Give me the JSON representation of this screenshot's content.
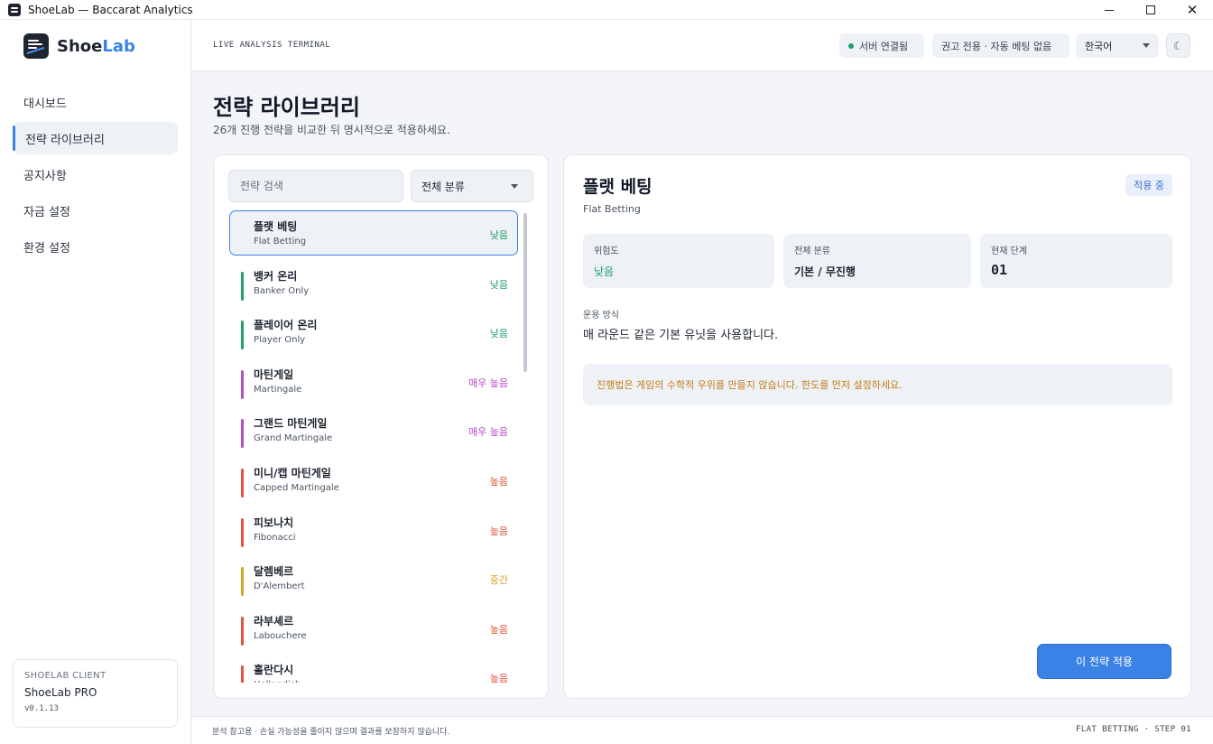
{
  "window": {
    "title": "ShoeLab — Baccarat Analytics",
    "controls": {
      "minimize": "",
      "maximize": "",
      "close": "✕"
    }
  },
  "sidebar": {
    "brand": {
      "prefix": "Shoe",
      "accent": "Lab"
    },
    "items": [
      {
        "label": "대시보드"
      },
      {
        "label": "전략 라이브러리",
        "active": true
      },
      {
        "label": "공지사항"
      },
      {
        "label": "자금 설정"
      },
      {
        "label": "환경 설정"
      }
    ],
    "client": {
      "label": "SHOELAB CLIENT",
      "name": "ShoeLab PRO",
      "version": "v0.1.13"
    }
  },
  "topbar": {
    "terminal_label": "LIVE ANALYSIS TERMINAL",
    "server_status": "서버 연결됨",
    "advice": "권고 전용 · 자동 베팅 없음",
    "language": "한국어",
    "theme_icon": "☾",
    "status_color": "#22a06b"
  },
  "main": {
    "title": "전략 라이브러리",
    "subtitle": "26개 진행 전략을 비교한 뒤 명시적으로 적용하세요."
  },
  "list": {
    "search_placeholder": "전략 검색",
    "category": "전체 분류",
    "strategies": [
      {
        "name": "플랫 베팅",
        "en": "Flat Betting",
        "risk": "낮음",
        "color": "#22a06b",
        "selected": true
      },
      {
        "name": "뱅커 온리",
        "en": "Banker Only",
        "risk": "낮음",
        "color": "#22a06b"
      },
      {
        "name": "플레이어 온리",
        "en": "Player Only",
        "risk": "낮음",
        "color": "#22a06b"
      },
      {
        "name": "마틴게일",
        "en": "Martingale",
        "risk": "매우 높음",
        "color": "#b44ec4"
      },
      {
        "name": "그랜드 마틴게일",
        "en": "Grand Martingale",
        "risk": "매우 높음",
        "color": "#b44ec4"
      },
      {
        "name": "미니/캡 마틴게일",
        "en": "Capped Martingale",
        "risk": "높음",
        "color": "#e0533c"
      },
      {
        "name": "피보나치",
        "en": "Fibonacci",
        "risk": "높음",
        "color": "#e0533c"
      },
      {
        "name": "달렘베르",
        "en": "D'Alembert",
        "risk": "중간",
        "color": "#d9a126"
      },
      {
        "name": "라부셰르",
        "en": "Labouchere",
        "risk": "높음",
        "color": "#e0533c"
      },
      {
        "name": "홀란다시",
        "en": "Hollandish",
        "risk": "높음",
        "color": "#e0533c"
      }
    ]
  },
  "detail": {
    "title": "플랫 베팅",
    "subtitle": "Flat Betting",
    "badge": "적용 중",
    "stats": [
      {
        "label": "위험도",
        "value": "낮음"
      },
      {
        "label": "전체 분류",
        "value": "기본 / 무진행"
      },
      {
        "label": "현재 단계",
        "value": "01"
      }
    ],
    "method_label": "운용 방식",
    "method_text": "매 라운드 같은 기본 유닛을 사용합니다.",
    "warning": "진행법은 게임의 수학적 우위를 만들지 않습니다. 한도를 먼저 설정하세요.",
    "apply_label": "이 전략 적용",
    "accent_color": "#3b82e6",
    "warning_color": "#c27d1a"
  },
  "footer": {
    "disclaimer": "분석 참고용 · 손실 가능성을 줄이지 않으며 결과를 보장하지 않습니다.",
    "status": "FLAT BETTING · STEP 01"
  }
}
